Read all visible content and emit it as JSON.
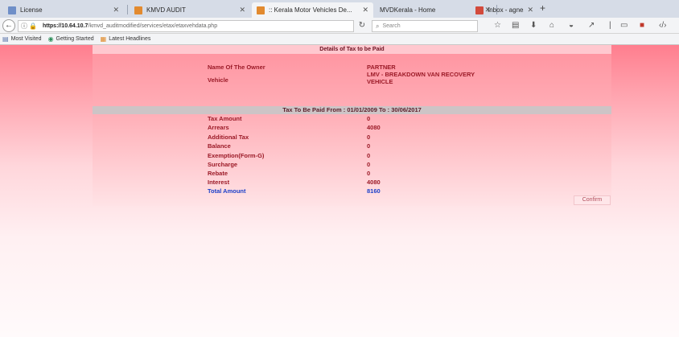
{
  "tabs": [
    {
      "label": "License",
      "fav": "#6f8fc8"
    },
    {
      "label": "KMVD AUDIT",
      "fav": "#e28a2f"
    },
    {
      "label": ":: Kerala Motor Vehicles De...",
      "fav": "#e28a2f"
    },
    {
      "label": "MVDKerala - Home",
      "fav": ""
    },
    {
      "label": "Inbox - agnespsm@gmail....",
      "fav": "#d24a3c"
    }
  ],
  "nav": {
    "url_host": "https://10.64.10.7",
    "url_rest": "/kmvd_auditmodified/services/etax/etaxvehdata.php",
    "search_placeholder": "Search"
  },
  "bookmarks": [
    "Most Visited",
    "Getting Started",
    "Latest Headlines"
  ],
  "panel": {
    "title": "Details of Tax to be Paid",
    "owner_label": "Name Of The Owner",
    "owner_value": "PARTNER",
    "vehicle_label": "Vehicle",
    "vehicle_value_1": "LMV - BREAKDOWN VAN RECOVERY",
    "vehicle_value_2": "VEHICLE",
    "period": "Tax To Be Paid   From : 01/01/2009   To : 30/06/2017",
    "rows": [
      {
        "label": "Tax Amount",
        "value": "0"
      },
      {
        "label": "Arrears",
        "value": "4080"
      },
      {
        "label": "Additional Tax",
        "value": "0"
      },
      {
        "label": "Balance",
        "value": "0"
      },
      {
        "label": "Exemption(Form-G)",
        "value": "0"
      },
      {
        "label": "Surcharge",
        "value": "0"
      },
      {
        "label": "Rebate",
        "value": "0"
      },
      {
        "label": "Interest",
        "value": "4080"
      }
    ],
    "total_label": "Total Amount",
    "total_value": "8160",
    "confirm_label": "Confirm"
  },
  "colors": {
    "accent_text": "#9b1a27",
    "total_text": "#1a3fc9"
  }
}
